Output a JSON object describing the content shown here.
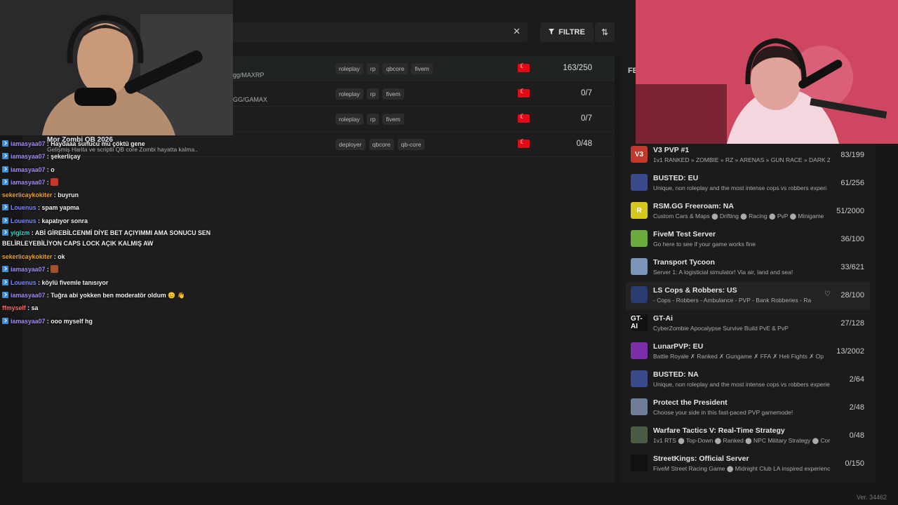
{
  "search": {
    "clear_icon": "close-icon"
  },
  "toolbar": {
    "filter_label": "FILTRE",
    "sort_icon": "sort-arrows-icon",
    "filter_icon": "filter-funnel-icon"
  },
  "servers": [
    {
      "host": "gg/MAXRP",
      "tags": [
        "roleplay",
        "rp",
        "qbcore",
        "fivem"
      ],
      "players": "163/250",
      "flag": "turkey-flag-icon"
    },
    {
      "host": "GG/GAMAX",
      "tags": [
        "roleplay",
        "rp",
        "fivem"
      ],
      "players": "0/7",
      "flag": "turkey-flag-icon"
    },
    {
      "host": "",
      "tags": [
        "roleplay",
        "rp",
        "fivem"
      ],
      "players": "0/7",
      "flag": "turkey-flag-icon"
    },
    {
      "host": "",
      "title": "Mor Zombi QB 2026",
      "desc": "Gelişmiş Harita ve scriptli QB core Zombi hayatta kalma..",
      "tags": [
        "deployer",
        "qbcore",
        "qb-core"
      ],
      "players": "0/48",
      "flag": "turkey-flag-icon"
    }
  ],
  "featured": {
    "label": "FE",
    "items": [
      {
        "name": "V3 PVP #1",
        "desc": "1v1 RANKED » ZOMBIE » RZ » ARENAS » GUN RACE » DARK Z",
        "count": "83/199",
        "icon": "V3",
        "color": "#c0392b"
      },
      {
        "name": "BUSTED: EU",
        "desc": "Unique, non roleplay and the most intense cops vs robbers experi",
        "count": "61/256",
        "icon": "busted-logo-icon",
        "color": "#3a4a8a"
      },
      {
        "name": "RSM.GG Freeroam: NA",
        "desc": "Custom Cars & Maps ⬤ Drifting ⬤ Racing ⬤ PvP ⬤ Minigame",
        "count": "51/2000",
        "icon": "R",
        "color": "#d6c81e"
      },
      {
        "name": "FiveM Test Server",
        "desc": "Go here to see if your game works fine",
        "count": "36/100",
        "icon": "fivem-logo-icon",
        "color": "#6aaa3e"
      },
      {
        "name": "Transport Tycoon",
        "desc": "Server 1: A logisticial simulator! Via air, land and sea!",
        "count": "33/621",
        "icon": "transport-tycoon-icon",
        "color": "#7a96b8"
      },
      {
        "name": "LS Cops & Robbers: US",
        "desc": "- Cops - Robbers - Ambulance - PVP - Bank Robberies - Ra",
        "count": "28/100",
        "icon": "lscr-logo-icon",
        "color": "#2b3b72"
      },
      {
        "name": "GT-Ai",
        "desc": "CyberZombie Apocalypse Survive Build PvE & PvP",
        "count": "27/128",
        "icon": "GT-AI",
        "color": "#111111"
      },
      {
        "name": "LunarPVP: EU",
        "desc": "Battle Royale ✗ Ranked ✗ Gungame ✗ FFA ✗ Heli Fights ✗ Op",
        "count": "13/2002",
        "icon": "lunar-logo-icon",
        "color": "#7a2fa8"
      },
      {
        "name": "BUSTED: NA",
        "desc": "Unique, non roleplay and the most intense cops vs robbers experien",
        "count": "2/64",
        "icon": "busted-logo-icon",
        "color": "#3a4a8a"
      },
      {
        "name": "Protect the President",
        "desc": "Choose your side in this fast-paced PVP gamemode!",
        "count": "2/48",
        "icon": "president-seal-icon",
        "color": "#6d7f96"
      },
      {
        "name": "Warfare Tactics V: Real-Time Strategy",
        "desc": "1v1 RTS ⬤ Top-Down ⬤ Ranked ⬤ NPC Military Strategy ⬤ Comm",
        "count": "0/48",
        "icon": "warfare-logo-icon",
        "color": "#4d5a45"
      },
      {
        "name": "StreetKings: Official Server",
        "desc": "FiveM Street Racing Game ⬤ Midnight Club LA inspired experienc",
        "count": "0/150",
        "icon": "streetkings-logo-icon",
        "color": "#111111"
      }
    ]
  },
  "version": "Ver. 34462",
  "chat": [
    {
      "user": "iamasyaa07",
      "color": "#a78bfa",
      "badge": true,
      "msg": "Haydaaa sunucu mu çöktü gene"
    },
    {
      "user": "iamasyaa07",
      "color": "#a78bfa",
      "badge": true,
      "msg": "şekerliçay"
    },
    {
      "user": "iamasyaa07",
      "color": "#a78bfa",
      "badge": true,
      "msg": "o"
    },
    {
      "user": "iamasyaa07",
      "color": "#a78bfa",
      "badge": true,
      "msg": "",
      "emote": "#c0392b"
    },
    {
      "user": "sekerlicaykokiter",
      "color": "#f0a030",
      "badge": false,
      "msg": "buyrun"
    },
    {
      "user": "Louenus",
      "color": "#7b8cff",
      "badge": true,
      "msg": "spam yapma"
    },
    {
      "user": "Louenus",
      "color": "#7b8cff",
      "badge": true,
      "msg": "kapatıyor sonra"
    },
    {
      "user": "yiglzm",
      "color": "#2ed3c6",
      "badge": true,
      "msg": "ABİ GİREBİLCENMİ DİYE BET AÇIYIMMI AMA SONUCU SEN BELİRLEYEBİLİYON CAPS LOCK AÇIK KALMIŞ AW",
      "wrap": true
    },
    {
      "user": "sekerlicaykokiter",
      "color": "#f0a030",
      "badge": false,
      "msg": "ok"
    },
    {
      "user": "iamasyaa07",
      "color": "#a78bfa",
      "badge": true,
      "msg": "",
      "emote": "#a0522d"
    },
    {
      "user": "Louenus",
      "color": "#7b8cff",
      "badge": true,
      "msg": "köylü fivemle tanısıyor"
    },
    {
      "user": "iamasyaa07",
      "color": "#a78bfa",
      "badge": true,
      "msg": "Tuğra abi yokken ben moderatör oldum 😊 👋"
    },
    {
      "user": "ffmyself",
      "color": "#ff6b6b",
      "badge": false,
      "msg": "sa"
    },
    {
      "user": "iamasyaa07",
      "color": "#a78bfa",
      "badge": true,
      "msg": "ooo myself hg"
    }
  ]
}
